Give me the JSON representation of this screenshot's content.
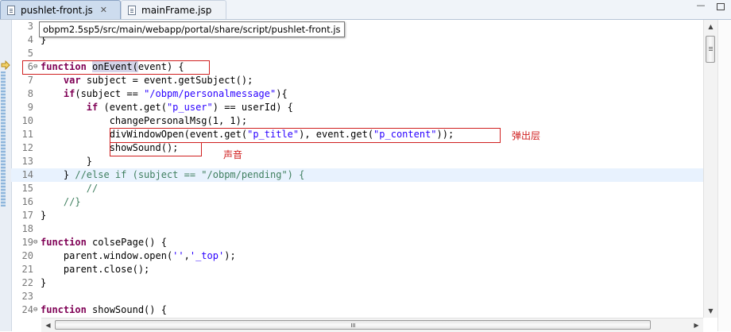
{
  "tabs": [
    {
      "label": "pushlet-front.js",
      "active": true,
      "close": "✕"
    },
    {
      "label": "mainFrame.jsp",
      "active": false
    }
  ],
  "window": {
    "minimize": "—",
    "maximize": ""
  },
  "tooltip": "obpm2.5sp5/src/main/webapp/portal/share/script/pushlet-front.js",
  "lines": [
    {
      "n": "3",
      "text": ""
    },
    {
      "n": "4",
      "text": "}"
    },
    {
      "n": "5",
      "text": ""
    },
    {
      "n": "6",
      "text": "function onEvent(event) {"
    },
    {
      "n": "7",
      "text": "    var subject = event.getSubject();"
    },
    {
      "n": "8",
      "text": "    if(subject == \"/obpm/personalmessage\"){"
    },
    {
      "n": "9",
      "text": "        if (event.get(\"p_user\") == userId) {"
    },
    {
      "n": "10",
      "text": "            changePersonalMsg(1, 1);"
    },
    {
      "n": "11",
      "text": "            divWindowOpen(event.get(\"p_title\"), event.get(\"p_content\"));"
    },
    {
      "n": "12",
      "text": "            showSound();"
    },
    {
      "n": "13",
      "text": "        }"
    },
    {
      "n": "14",
      "text": "    } //else if (subject == \"/obpm/pending\") {"
    },
    {
      "n": "15",
      "text": "        //"
    },
    {
      "n": "16",
      "text": "    //}"
    },
    {
      "n": "17",
      "text": "}"
    },
    {
      "n": "18",
      "text": ""
    },
    {
      "n": "19",
      "text": "function colsePage() {"
    },
    {
      "n": "20",
      "text": "    parent.window.open('','_top');"
    },
    {
      "n": "21",
      "text": "    parent.close();"
    },
    {
      "n": "22",
      "text": "}"
    },
    {
      "n": "23",
      "text": ""
    },
    {
      "n": "24",
      "text": "function showSound() {"
    }
  ],
  "annotations": {
    "popup_layer": "弹出层",
    "sound": "声音"
  },
  "colors": {
    "keyword": "#7f0055",
    "string": "#2a00ff",
    "comment": "#3f7f5f",
    "annotation_red": "#d02020",
    "current_line": "#e8f2fe"
  }
}
